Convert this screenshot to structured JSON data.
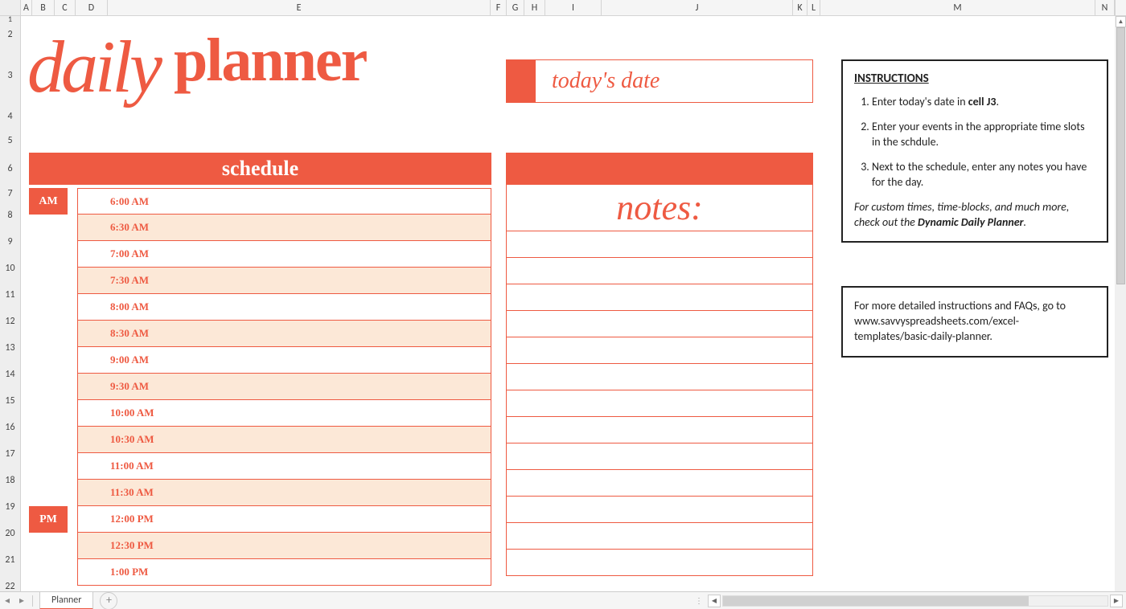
{
  "columns": [
    "A",
    "B",
    "C",
    "D",
    "E",
    "F",
    "G",
    "H",
    "I",
    "J",
    "K",
    "L",
    "M",
    "N"
  ],
  "rownums": [
    "1",
    "2",
    "3",
    "4",
    "5",
    "6",
    "7",
    "8",
    "9",
    "10",
    "11",
    "12",
    "13",
    "14",
    "15",
    "16",
    "17",
    "18",
    "19",
    "20",
    "21",
    "22"
  ],
  "accent_color": "#ee5a42",
  "alt_row_color": "#fce8d7",
  "title": {
    "word1": "daily",
    "word2": "planner"
  },
  "todays_date_label": "today's date",
  "schedule": {
    "header": "schedule",
    "am_label": "AM",
    "pm_label": "PM",
    "rows": [
      {
        "time": "6:00 AM",
        "alt": false
      },
      {
        "time": "6:30 AM",
        "alt": true
      },
      {
        "time": "7:00 AM",
        "alt": false
      },
      {
        "time": "7:30 AM",
        "alt": true
      },
      {
        "time": "8:00 AM",
        "alt": false
      },
      {
        "time": "8:30 AM",
        "alt": true
      },
      {
        "time": "9:00 AM",
        "alt": false
      },
      {
        "time": "9:30 AM",
        "alt": true
      },
      {
        "time": "10:00 AM",
        "alt": false
      },
      {
        "time": "10:30 AM",
        "alt": true
      },
      {
        "time": "11:00 AM",
        "alt": false
      },
      {
        "time": "11:30 AM",
        "alt": true
      },
      {
        "time": "12:00 PM",
        "alt": false
      },
      {
        "time": "12:30 PM",
        "alt": true
      },
      {
        "time": "1:00 PM",
        "alt": false
      }
    ]
  },
  "notes": {
    "title": "notes:",
    "lines_count": 13
  },
  "instructions": {
    "heading": "INSTRUCTIONS",
    "items": [
      {
        "pre": "Enter today's date in ",
        "bold": "cell J3",
        "post": "."
      },
      {
        "pre": "Enter your events in the appropriate time slots in the schdule.",
        "bold": "",
        "post": ""
      },
      {
        "pre": "Next to the schedule, enter any notes you have for the day.",
        "bold": "",
        "post": ""
      }
    ],
    "footer_pre": "For custom times, time-blocks, and much more, check out the ",
    "footer_bold": "Dynamic Daily Planner",
    "footer_post": "."
  },
  "instructions2": "For more detailed instructions and FAQs, go to www.savvyspreadsheets.com/excel-templates/basic-daily-planner.",
  "tabs": {
    "prev": "◂",
    "next": "▸",
    "active": "Planner",
    "add": "+"
  }
}
